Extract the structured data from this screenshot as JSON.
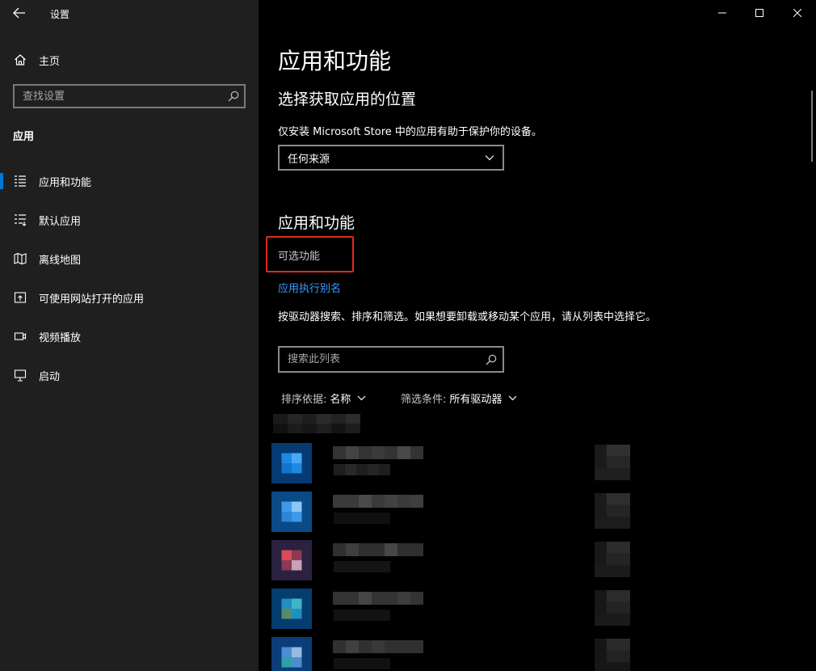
{
  "window": {
    "title": "设置",
    "back_icon": "arrow-left-icon",
    "controls": [
      "minimize-icon",
      "maximize-icon",
      "close-icon"
    ]
  },
  "sidebar": {
    "home_label": "主页",
    "search_placeholder": "查找设置",
    "section_title": "应用",
    "items": [
      {
        "label": "应用和功能",
        "icon": "list-icon",
        "active": true
      },
      {
        "label": "默认应用",
        "icon": "list-default-icon",
        "active": false
      },
      {
        "label": "离线地图",
        "icon": "map-icon",
        "active": false
      },
      {
        "label": "可使用网站打开的应用",
        "icon": "open-web-icon",
        "active": false
      },
      {
        "label": "视频播放",
        "icon": "video-icon",
        "active": false
      },
      {
        "label": "启动",
        "icon": "startup-icon",
        "active": false
      }
    ]
  },
  "main": {
    "page_title": "应用和功能",
    "source_section": {
      "title": "选择获取应用的位置",
      "description": "仅安装 Microsoft Store 中的应用有助于保护你的设备。",
      "dropdown_value": "任何来源"
    },
    "apps_section": {
      "title": "应用和功能",
      "optional_features_link": "可选功能",
      "alias_link": "应用执行别名",
      "description": "按驱动器搜索、排序和筛选。如果想要卸载或移动某个应用，请从列表中选择它。",
      "list_search_placeholder": "搜索此列表",
      "sort_label": "排序依据:",
      "sort_value": "名称",
      "filter_label": "筛选条件:",
      "filter_value": "所有驱动器"
    }
  },
  "colors": {
    "sidebar_bg": "#1f1f1f",
    "main_bg": "#000000",
    "accent": "#0078d7",
    "link": "#3b9cff",
    "highlight_box": "#e02a20"
  }
}
